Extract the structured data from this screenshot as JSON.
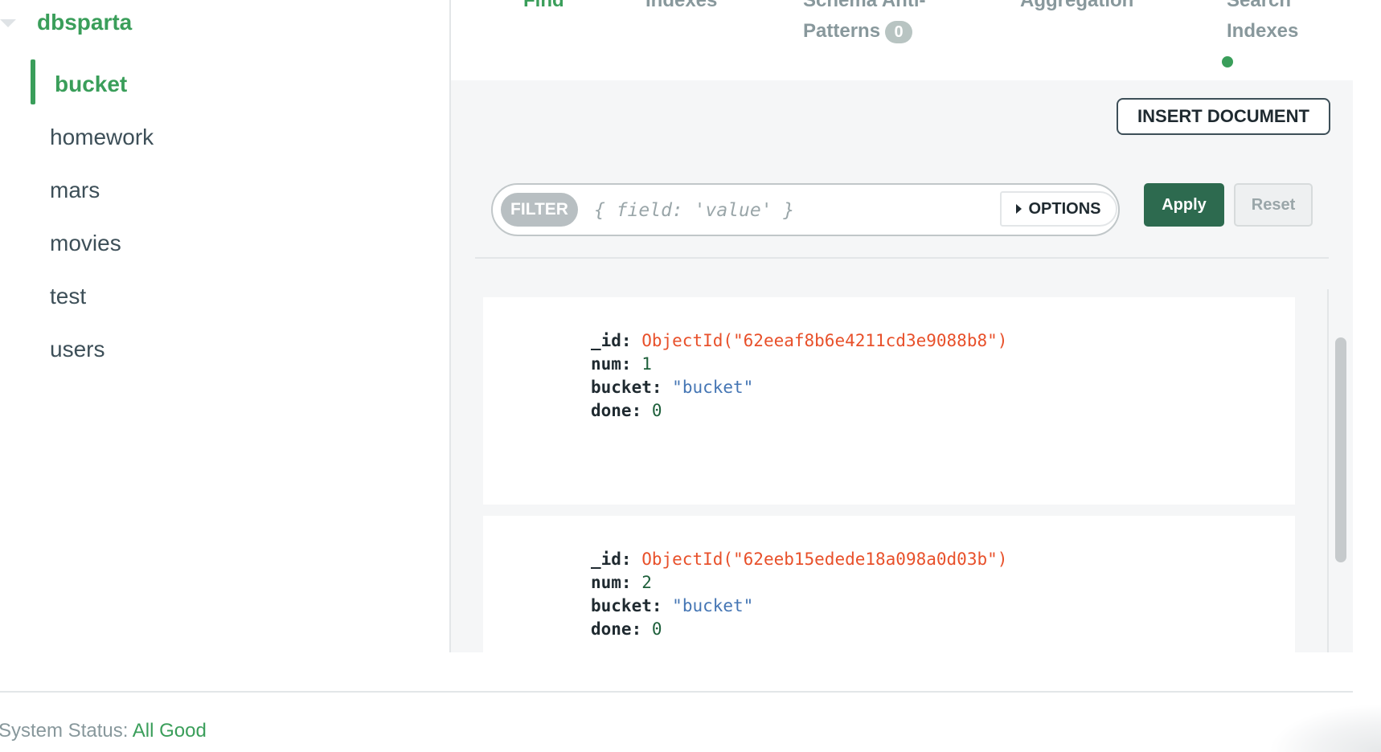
{
  "sidebar": {
    "database": "dbsparta",
    "collections": [
      {
        "label": "bucket",
        "active": true
      },
      {
        "label": "homework",
        "active": false
      },
      {
        "label": "mars",
        "active": false
      },
      {
        "label": "movies",
        "active": false
      },
      {
        "label": "test",
        "active": false
      },
      {
        "label": "users",
        "active": false
      }
    ]
  },
  "tabs": {
    "find": "Find",
    "indexes": "Indexes",
    "schema_anti_patterns": "Schema Anti-Patterns",
    "schema_anti_patterns_count": "0",
    "aggregation": "Aggregation",
    "search_indexes": "Search Indexes"
  },
  "toolbar": {
    "insert_label": "INSERT DOCUMENT",
    "filter_label": "FILTER",
    "filter_placeholder": "{ field: 'value' }",
    "options_label": "OPTIONS",
    "apply_label": "Apply",
    "reset_label": "Reset"
  },
  "documents": [
    {
      "id_key": "_id:",
      "id_val": "ObjectId(\"62eeaf8b6e4211cd3e9088b8\")",
      "num_key": "num:",
      "num_val": "1",
      "bucket_key": "bucket:",
      "bucket_val": "\"bucket\"",
      "done_key": "done:",
      "done_val": "0"
    },
    {
      "id_key": "_id:",
      "id_val": "ObjectId(\"62eeb15edede18a098a0d03b\")",
      "num_key": "num:",
      "num_val": "2",
      "bucket_key": "bucket:",
      "bucket_val": "\"bucket\"",
      "done_key": "done:",
      "done_val": "0"
    }
  ],
  "footer": {
    "label": "System Status: ",
    "status": "All Good"
  },
  "colors": {
    "accent_green": "#3a9e5a",
    "apply_green": "#2d6a4f",
    "objectid_red": "#e8502a",
    "string_blue": "#4576b4"
  }
}
